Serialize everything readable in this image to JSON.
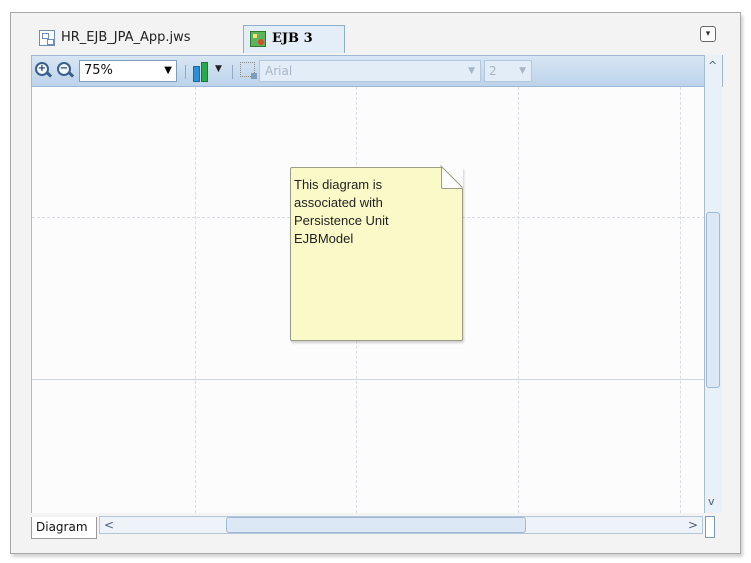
{
  "tabs": [
    {
      "label": "HR_EJB_JPA_App.jws",
      "icon": "workspace-icon",
      "active": false
    },
    {
      "label": "EJB 3",
      "icon": "ejb-diagram-icon",
      "active": true
    }
  ],
  "toolbar": {
    "zoom_in_icon": "zoom-in-icon",
    "zoom_out_icon": "zoom-out-icon",
    "zoom_value": "75%",
    "align_icon": "align-icon",
    "resize_icon": "resize-icon",
    "font_name": "Arial",
    "font_size": "2"
  },
  "note": {
    "lines": [
      "This diagram is",
      "associated with",
      "Persistence Unit",
      "EJBModel"
    ]
  },
  "bottom": {
    "diagram_tab": "Diagram"
  },
  "scroll": {
    "vertical_position": 0.4,
    "horizontal_position": 0.5
  }
}
